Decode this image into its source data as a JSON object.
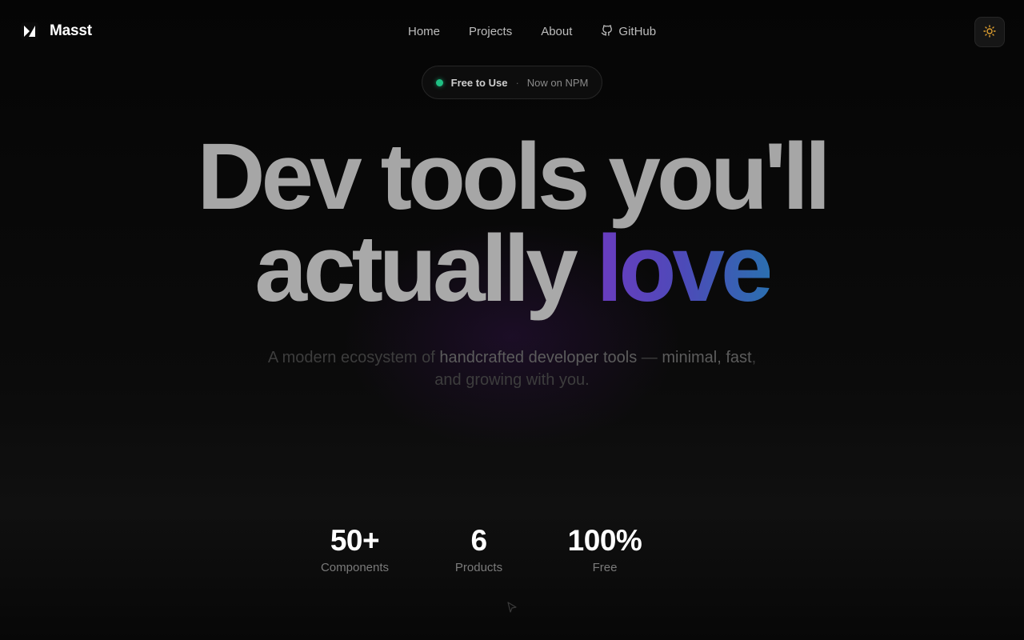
{
  "brand": {
    "name": "Masst",
    "logo_icon": "masst-logo-icon"
  },
  "nav": {
    "items": [
      {
        "label": "Home"
      },
      {
        "label": "Projects"
      },
      {
        "label": "About"
      },
      {
        "label": "GitHub",
        "icon": "github-icon"
      }
    ]
  },
  "theme_toggle": {
    "icon": "sun-icon",
    "color": "#e0a030"
  },
  "badge": {
    "primary": "Free to Use",
    "separator": "·",
    "secondary": "Now on NPM",
    "dot_color": "#1fbf83"
  },
  "hero": {
    "line1": "Dev tools you'll",
    "line2_plain": "actually ",
    "line2_accent": "love",
    "accent_gradient": [
      "#6a3cc0",
      "#4d4ab8",
      "#2b6fb0"
    ]
  },
  "subtitle": {
    "part1": "A modern ecosystem of ",
    "highlight1": "handcrafted developer tools",
    "part2": " — ",
    "highlight2": "minimal, fast",
    "part3": ", and growing with you."
  },
  "stats": [
    {
      "value": "50+",
      "label": "Components"
    },
    {
      "value": "6",
      "label": "Products"
    },
    {
      "value": "100%",
      "label": "Free"
    }
  ]
}
